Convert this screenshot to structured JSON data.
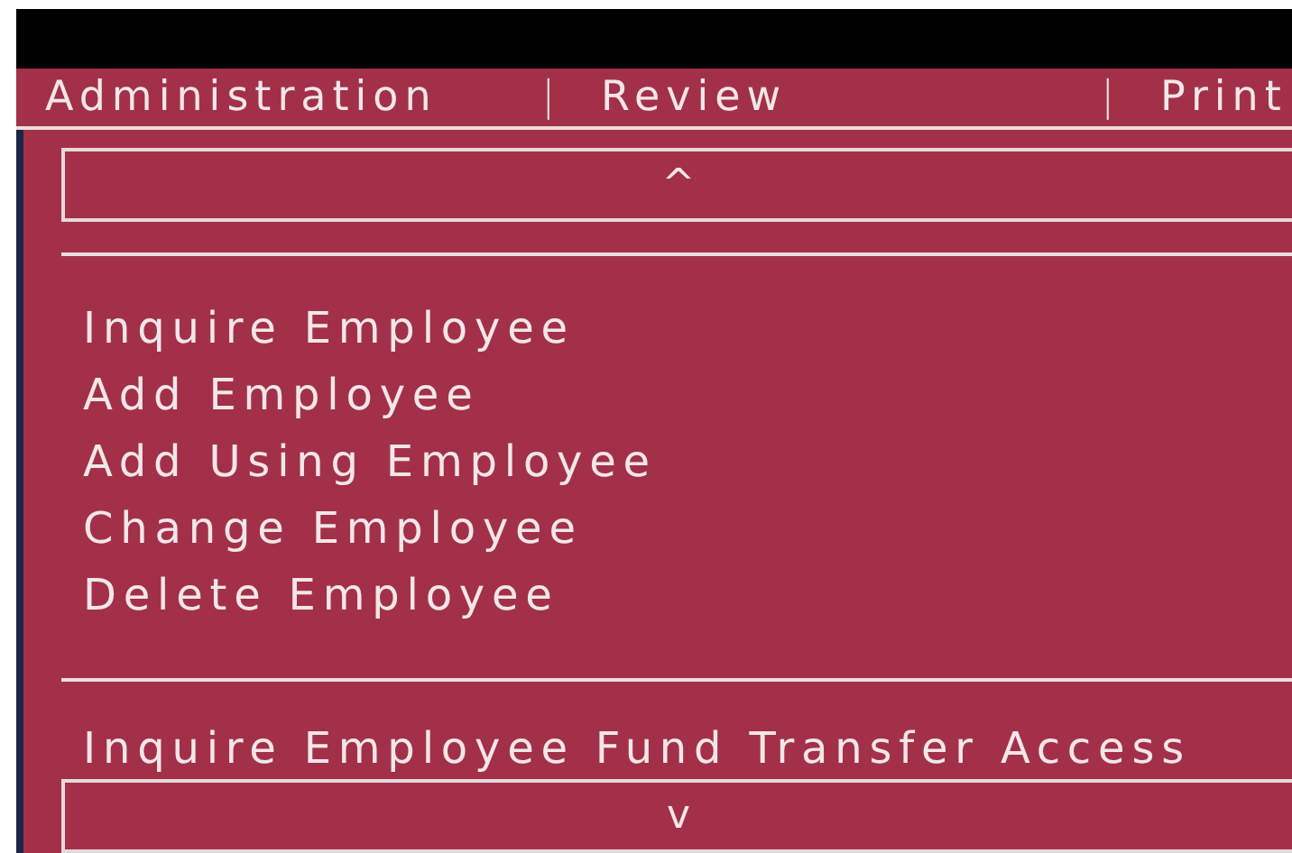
{
  "menu_bar": [
    {
      "kind": "item",
      "label": "Administration"
    },
    {
      "kind": "separator",
      "label": "|"
    },
    {
      "kind": "item",
      "label": "Review"
    },
    {
      "kind": "separator",
      "label": "|"
    },
    {
      "kind": "item",
      "label": "Print"
    }
  ],
  "scroll_up": {
    "label": "^"
  },
  "groups": [
    {
      "items": [
        "Inquire Employee",
        "Add Employee",
        "Add Using Employee",
        "Change Employee",
        "Delete Employee"
      ]
    },
    {
      "items": [
        "Inquire Employee Fund Transfer Access"
      ]
    }
  ],
  "scroll_down": {
    "label": "v"
  }
}
